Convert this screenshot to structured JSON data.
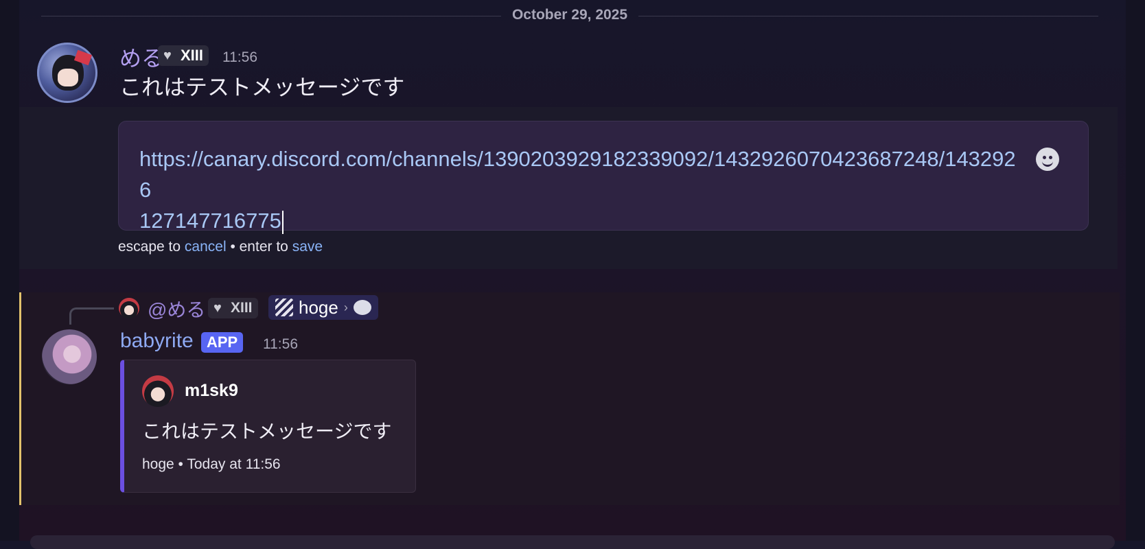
{
  "date_divider": "October 29, 2025",
  "message1": {
    "author": "める",
    "role_tag": "XIII",
    "time": "11:56",
    "content": "これはテストメッセージです",
    "edit": {
      "value_line1": "https://canary.discord.com/channels/1390203929182339092/1432926070423687248/1432926",
      "value_line2": "127147716775",
      "hint_escape": "escape to ",
      "hint_cancel": "cancel",
      "hint_sep": " • enter to ",
      "hint_save": "save",
      "emoji_icon": "smiley-face-icon"
    }
  },
  "message2": {
    "reply": {
      "mention": "@める",
      "role_tag": "XIII",
      "channel": "hoge",
      "separator": "›"
    },
    "author": "babyrite",
    "badge": "APP",
    "time": "11:56",
    "embed": {
      "author": "m1sk9",
      "description": "これはテストメッセージです",
      "footer": "hoge • Today at 11:56",
      "accent_color": "#6b4fe0"
    }
  },
  "colors": {
    "author1": "#b39ff0",
    "author2": "#8ea9f2",
    "link": "#a9c8f5",
    "app_badge": "#5865f2",
    "highlight_bar": "#e2c26c"
  }
}
